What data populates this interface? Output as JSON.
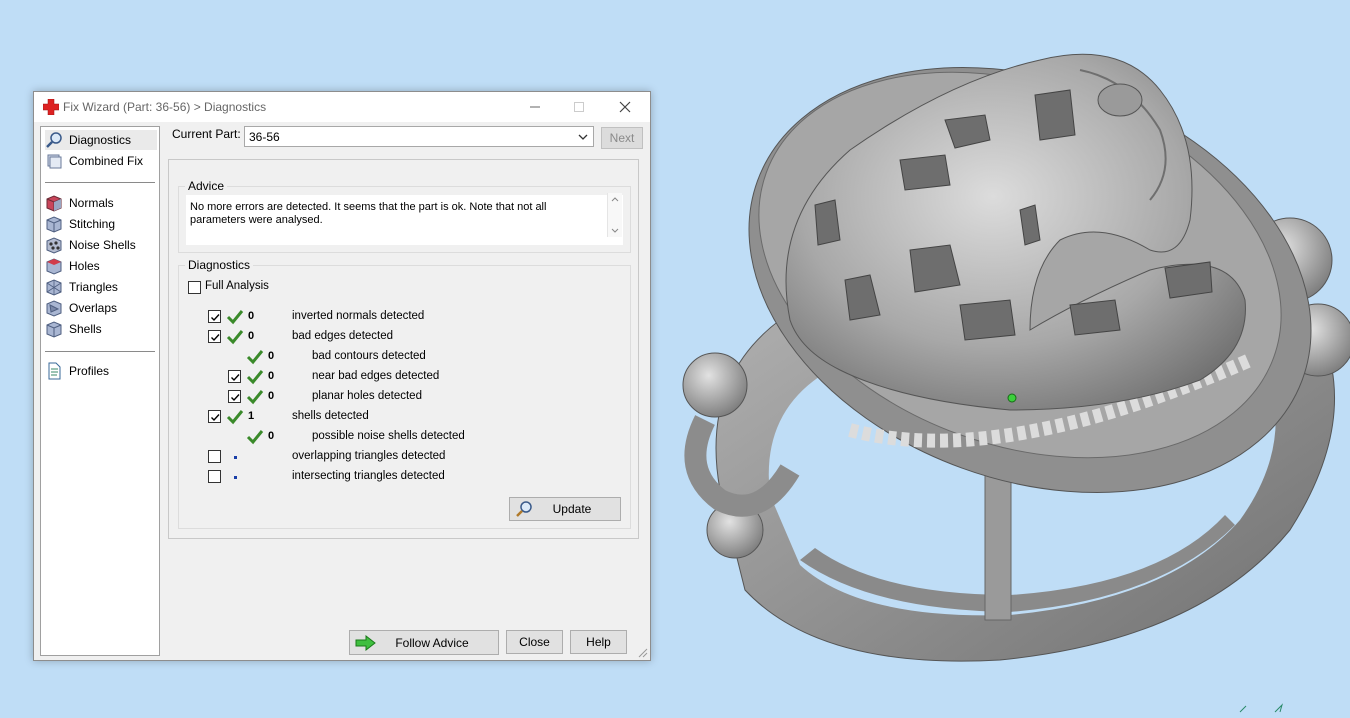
{
  "window": {
    "title": "Fix Wizard (Part: 36-56) > Diagnostics"
  },
  "sidebar": {
    "items": [
      {
        "label": "Diagnostics",
        "icon": "magnifier-icon",
        "active": true
      },
      {
        "label": "Combined Fix",
        "icon": "cubes-icon"
      },
      {
        "label": "Normals",
        "icon": "normals-cube-icon"
      },
      {
        "label": "Stitching",
        "icon": "stitching-cube-icon"
      },
      {
        "label": "Noise Shells",
        "icon": "noise-shells-icon"
      },
      {
        "label": "Holes",
        "icon": "holes-cube-icon"
      },
      {
        "label": "Triangles",
        "icon": "triangles-icon"
      },
      {
        "label": "Overlaps",
        "icon": "overlaps-icon"
      },
      {
        "label": "Shells",
        "icon": "shells-icon"
      },
      {
        "label": "Profiles",
        "icon": "document-icon"
      }
    ]
  },
  "current_part": {
    "label": "Current Part:",
    "value": "36-56"
  },
  "next_label": "Next",
  "advice": {
    "title": "Advice",
    "text": "No more errors are detected. It seems that the part is ok. Note that not all parameters were analysed."
  },
  "diagnostics": {
    "title": "Diagnostics",
    "full_analysis_label": "Full Analysis",
    "rows": [
      {
        "checked": true,
        "status": "ok",
        "count": "0",
        "label": "inverted normals detected"
      },
      {
        "checked": true,
        "status": "ok",
        "count": "0",
        "label": "bad edges detected"
      },
      {
        "checked": null,
        "status": "ok",
        "count": "0",
        "label": "bad contours detected"
      },
      {
        "checked": true,
        "status": "ok",
        "count": "0",
        "label": "near bad edges detected"
      },
      {
        "checked": true,
        "status": "ok",
        "count": "0",
        "label": "planar holes detected"
      },
      {
        "checked": true,
        "status": "ok",
        "count": "1",
        "label": "shells detected"
      },
      {
        "checked": null,
        "status": "ok",
        "count": "0",
        "label": "possible noise shells detected"
      },
      {
        "checked": false,
        "status": "pending",
        "count": "",
        "label": "overlapping triangles detected"
      },
      {
        "checked": false,
        "status": "pending",
        "count": "",
        "label": "intersecting triangles detected"
      }
    ],
    "update_label": "Update"
  },
  "footer": {
    "follow_advice": "Follow Advice",
    "close": "Close",
    "help": "Help"
  },
  "colors": {
    "background": "#bfddf6",
    "check": "#3a8a2a",
    "model": "#9c9c9c"
  }
}
